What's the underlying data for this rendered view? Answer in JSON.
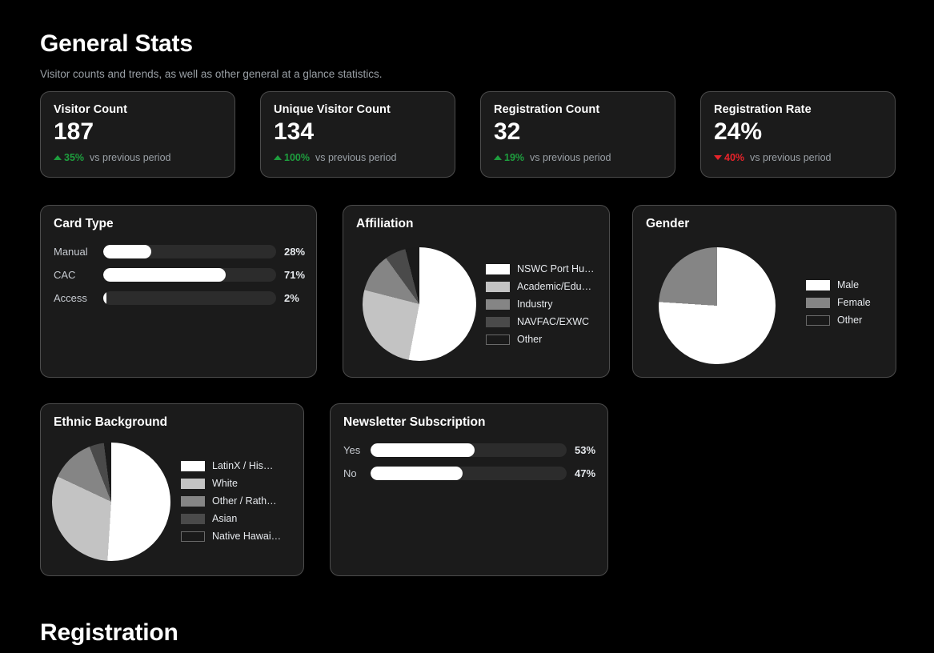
{
  "sections": {
    "general_stats": {
      "title": "General Stats",
      "subtitle": "Visitor counts and trends, as well as other general at a glance statistics."
    },
    "registration": {
      "title": "Registration"
    }
  },
  "stat_cards": [
    {
      "label": "Visitor Count",
      "value": "187",
      "delta": "35%",
      "direction": "up",
      "note": "vs previous period"
    },
    {
      "label": "Unique Visitor Count",
      "value": "134",
      "delta": "100%",
      "direction": "up",
      "note": "vs previous period"
    },
    {
      "label": "Registration Count",
      "value": "32",
      "delta": "19%",
      "direction": "up",
      "note": "vs previous period"
    },
    {
      "label": "Registration Rate",
      "value": "24%",
      "delta": "40%",
      "direction": "down",
      "note": "vs previous period"
    }
  ],
  "panels": {
    "card_type": {
      "title": "Card Type"
    },
    "affiliation": {
      "title": "Affiliation"
    },
    "gender": {
      "title": "Gender"
    },
    "ethnic_background": {
      "title": "Ethnic Background"
    },
    "newsletter": {
      "title": "Newsletter Subscription"
    }
  },
  "colors": {
    "page_background": "#000000",
    "card_background": "#1b1b1b",
    "card_border": "#4c4c4c",
    "bar_track": "#2c2c2c",
    "bar_fill": "#ffffff",
    "positive": "#1e9e3e",
    "negative": "#e8232a",
    "muted_text": "#9aa0a6",
    "slice_1": "#ffffff",
    "slice_2": "#c3c3c3",
    "slice_3": "#858585",
    "slice_4": "#4a4a4a",
    "slice_5": "#1a1a1a"
  },
  "chart_data": [
    {
      "type": "bar",
      "title": "Card Type",
      "orientation": "horizontal",
      "categories": [
        "Manual",
        "CAC",
        "Access"
      ],
      "values": [
        28,
        71,
        2
      ],
      "value_labels": [
        "28%",
        "71%",
        "2%"
      ],
      "unit": "%",
      "xlim": [
        0,
        100
      ],
      "grid": false
    },
    {
      "type": "pie",
      "title": "Affiliation",
      "legend_position": "right",
      "labels": [
        "NSWC Port Hu…",
        "Academic/Edu…",
        "Industry",
        "NAVFAC/EXWC",
        "Other"
      ],
      "values": [
        53,
        26,
        11,
        6,
        4
      ],
      "colors": [
        "#ffffff",
        "#c3c3c3",
        "#858585",
        "#4a4a4a",
        "#1a1a1a"
      ]
    },
    {
      "type": "pie",
      "title": "Gender",
      "legend_position": "right",
      "labels": [
        "Male",
        "Female",
        "Other"
      ],
      "values": [
        76,
        24,
        0
      ],
      "colors": [
        "#ffffff",
        "#858585",
        "#1a1a1a"
      ]
    },
    {
      "type": "pie",
      "title": "Ethnic Background",
      "legend_position": "right",
      "labels": [
        "LatinX / His…",
        "White",
        "Other / Rath…",
        "Asian",
        "Native Hawai…"
      ],
      "values": [
        51,
        31,
        12,
        4,
        2
      ],
      "colors": [
        "#ffffff",
        "#c3c3c3",
        "#858585",
        "#4a4a4a",
        "#1a1a1a"
      ]
    },
    {
      "type": "bar",
      "title": "Newsletter Subscription",
      "orientation": "horizontal",
      "categories": [
        "Yes",
        "No"
      ],
      "values": [
        53,
        47
      ],
      "value_labels": [
        "53%",
        "47%"
      ],
      "unit": "%",
      "xlim": [
        0,
        100
      ],
      "grid": false
    }
  ]
}
